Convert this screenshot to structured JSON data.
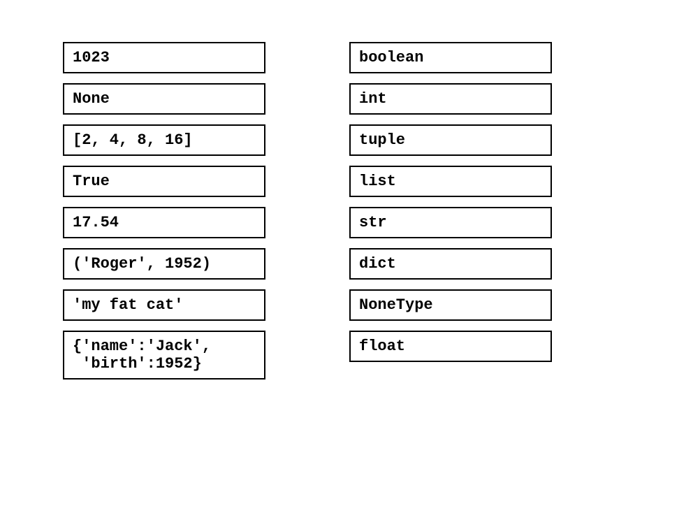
{
  "left_column": [
    "1023",
    "None",
    "[2, 4, 8, 16]",
    "True",
    "17.54",
    "('Roger', 1952)",
    "'my fat cat'",
    "{'name':'Jack',\n 'birth':1952}"
  ],
  "right_column": [
    "boolean",
    "int",
    "tuple",
    "list",
    "str",
    "dict",
    "NoneType",
    "float"
  ]
}
